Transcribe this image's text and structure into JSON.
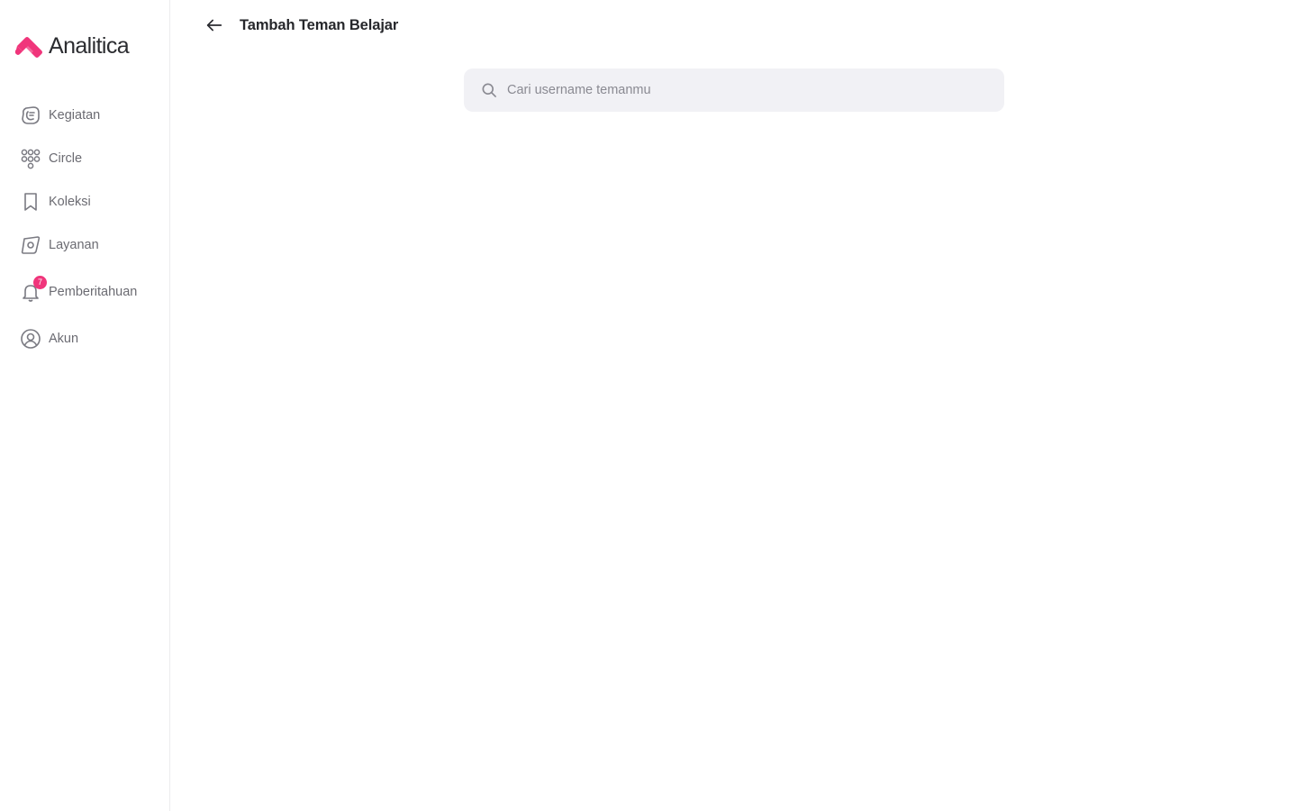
{
  "brand": {
    "name": "Analitica",
    "accent_color": "#f0357b"
  },
  "sidebar": {
    "items": [
      {
        "icon": "activity-icon",
        "label": "Kegiatan"
      },
      {
        "icon": "circle-group-icon",
        "label": "Circle"
      },
      {
        "icon": "bookmark-icon",
        "label": "Koleksi"
      },
      {
        "icon": "compass-icon",
        "label": "Layanan"
      },
      {
        "icon": "bell-icon",
        "label": "Pemberitahuan",
        "badge": "7"
      },
      {
        "icon": "user-icon",
        "label": "Akun"
      }
    ]
  },
  "header": {
    "back_icon": "arrow-left-icon",
    "title": "Tambah Teman Belajar"
  },
  "search": {
    "icon": "search-icon",
    "placeholder": "Cari username temanmu",
    "value": ""
  }
}
